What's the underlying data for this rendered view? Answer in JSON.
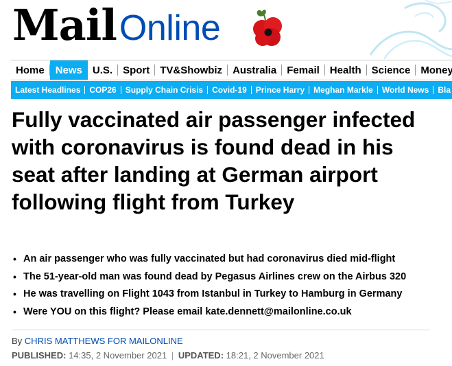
{
  "brand": {
    "logo_main": "Mail",
    "logo_online": "Online"
  },
  "nav_primary": {
    "items": [
      "Home",
      "News",
      "U.S.",
      "Sport",
      "TV&Showbiz",
      "Australia",
      "Femail",
      "Health",
      "Science",
      "Money"
    ],
    "active": "News"
  },
  "nav_secondary": {
    "items": [
      "Latest Headlines",
      "COP26",
      "Supply Chain Crisis",
      "Covid-19",
      "Prince Harry",
      "Meghan Markle",
      "World News",
      "Bla"
    ]
  },
  "article": {
    "headline": "Fully vaccinated air passenger infected with coronavirus is found dead in his seat after landing at German airport following flight from Turkey",
    "bullets": [
      "An air passenger who was fully vaccinated but had coronavirus died mid-flight",
      "The 51-year-old man was found dead by Pegasus Airlines crew on the Airbus 320",
      "He was travelling on Flight 1043 from Istanbul in Turkey to Hamburg in Germany",
      "Were YOU on this flight? Please email kate.dennett@mailonline.co.uk"
    ],
    "byline_prefix": "By",
    "author": "CHRIS MATTHEWS FOR MAILONLINE",
    "published_label": "PUBLISHED:",
    "published": "14:35, 2 November 2021",
    "updated_label": "UPDATED:",
    "updated": "18:21, 2 November 2021"
  },
  "colors": {
    "accent": "#0cadf3",
    "brand_blue": "#004db3",
    "poppy_red": "#d7141a"
  },
  "icons": {
    "poppy": "poppy-icon",
    "decoration": "swan-decoration"
  }
}
